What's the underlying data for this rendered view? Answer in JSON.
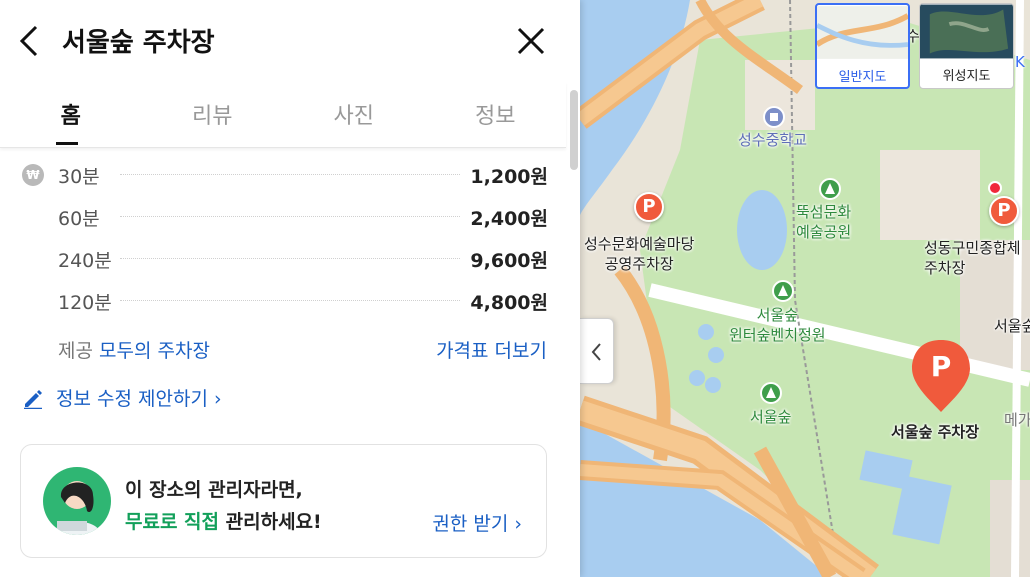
{
  "place": {
    "title": "서울숲 주차장"
  },
  "tabs": [
    {
      "label": "홈",
      "active": true
    },
    {
      "label": "리뷰",
      "active": false
    },
    {
      "label": "사진",
      "active": false
    },
    {
      "label": "정보",
      "active": false
    }
  ],
  "prices": {
    "currency_icon": "₩",
    "rows": [
      {
        "duration": "30분",
        "price": "1,200원"
      },
      {
        "duration": "60분",
        "price": "2,400원"
      },
      {
        "duration": "240분",
        "price": "9,600원"
      },
      {
        "duration": "120분",
        "price": "4,800원"
      }
    ],
    "provider_prefix": "제공",
    "provider_name": "모두의 주차장",
    "more_label": "가격표 더보기"
  },
  "edit": {
    "label": "정보 수정 제안하기",
    "chevron": "›"
  },
  "owner_card": {
    "line1": "이 장소의 관리자라면,",
    "line2_highlight": "무료로 직접",
    "line2_rest": " 관리하세요!",
    "claim_label": "권한 받기",
    "chevron": "›"
  },
  "map": {
    "layer_buttons": [
      {
        "label": "일반지도",
        "active": true
      },
      {
        "label": "위성지도",
        "active": false
      }
    ],
    "labels": {
      "school": "성수중학교",
      "park_culture": "뚝섬문화\n예술공원",
      "parking_culture": "성수문화예술마당\n공영주차장",
      "winter_garden": "서울숲\n윈터숲벤치정원",
      "seoul_forest": "서울숲",
      "sports": "성동구민종합체\n주차장",
      "seoul_forest_right": "서울숲",
      "selected_parking": "서울숲 주차장",
      "partial_top": "수",
      "partial_meta": "메가",
      "partial_k": "K"
    },
    "pin_letter": "P"
  },
  "colors": {
    "accent_blue": "#1a5fc4",
    "pin_red": "#f05a3c",
    "park_green": "#c8e6b4",
    "owner_green": "#12a05a"
  },
  "icons": [
    "back-arrow-icon",
    "close-icon",
    "won-icon",
    "pencil-icon",
    "chevron-right-icon",
    "chevron-left-icon",
    "parking-pin-icon",
    "tree-icon",
    "school-icon"
  ]
}
